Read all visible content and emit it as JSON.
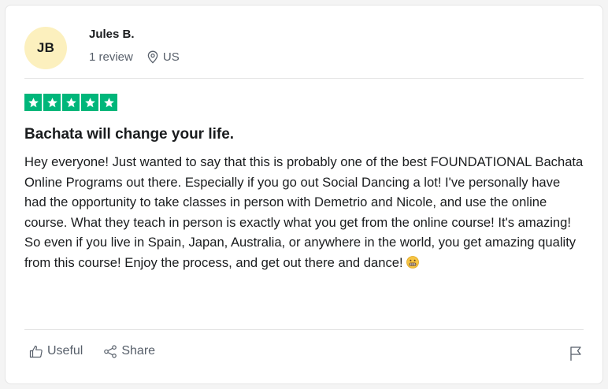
{
  "reviewer": {
    "initials": "JB",
    "name": "Jules B.",
    "review_count": "1 review",
    "country": "US",
    "avatar_color": "#fcf0be"
  },
  "rating": {
    "stars": 5,
    "max": 5,
    "color": "#00b67a"
  },
  "review": {
    "title": "Bachata will change your life.",
    "body": "Hey everyone! Just wanted to say that this is probably one of the best FOUNDATIONAL Bachata Online Programs out there. Especially if you go out Social Dancing a lot! I've personally have had the opportunity to take classes in person with Demetrio and Nicole, and use the online course. What they teach in person is exactly what you get from the online course! It's amazing! So even if you live in Spain, Japan, Australia, or anywhere in the world, you get amazing quality from this course! Enjoy the process, and get out there and dance!",
    "emoji": "grimacing-face-icon"
  },
  "actions": {
    "useful_label": "Useful",
    "share_label": "Share",
    "useful_icon": "thumbs-up-icon",
    "share_icon": "share-icon",
    "report_icon": "flag-icon"
  }
}
